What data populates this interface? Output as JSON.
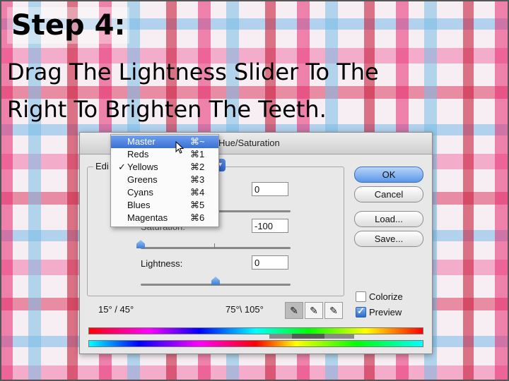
{
  "slide": {
    "title": "Step 4:",
    "subtitle": "Drag The Lightness Slider To The Right To Brighten The Teeth."
  },
  "dialog": {
    "title": "Hue/Saturation",
    "edit_label": "Edi",
    "hue_value": "0",
    "saturation_label": "Saturation:",
    "saturation_value": "-100",
    "lightness_label": "Lightness:",
    "lightness_value": "0",
    "buttons": {
      "ok": "OK",
      "cancel": "Cancel",
      "load": "Load...",
      "save": "Save..."
    },
    "colorize": {
      "label": "Colorize",
      "checked": false
    },
    "preview": {
      "label": "Preview",
      "checked": true
    },
    "range_left": "15° / 45°",
    "range_right": "75°\\ 105°"
  },
  "menu": {
    "items": [
      {
        "label": "Master",
        "shortcut": "⌘~",
        "check": "",
        "selected": true
      },
      {
        "label": "Reds",
        "shortcut": "⌘1",
        "check": ""
      },
      {
        "label": "Yellows",
        "shortcut": "⌘2",
        "check": "✓"
      },
      {
        "label": "Greens",
        "shortcut": "⌘3",
        "check": ""
      },
      {
        "label": "Cyans",
        "shortcut": "⌘4",
        "check": ""
      },
      {
        "label": "Blues",
        "shortcut": "⌘5",
        "check": ""
      },
      {
        "label": "Magentas",
        "shortcut": "⌘6",
        "check": ""
      }
    ]
  },
  "icons": [
    "eyedropper-icon",
    "eyedropper-plus-icon",
    "eyedropper-minus-icon",
    "pointer-cursor-icon"
  ],
  "colors": {
    "selected": "#3c6fd6",
    "primary_button": "#5a96e8"
  }
}
